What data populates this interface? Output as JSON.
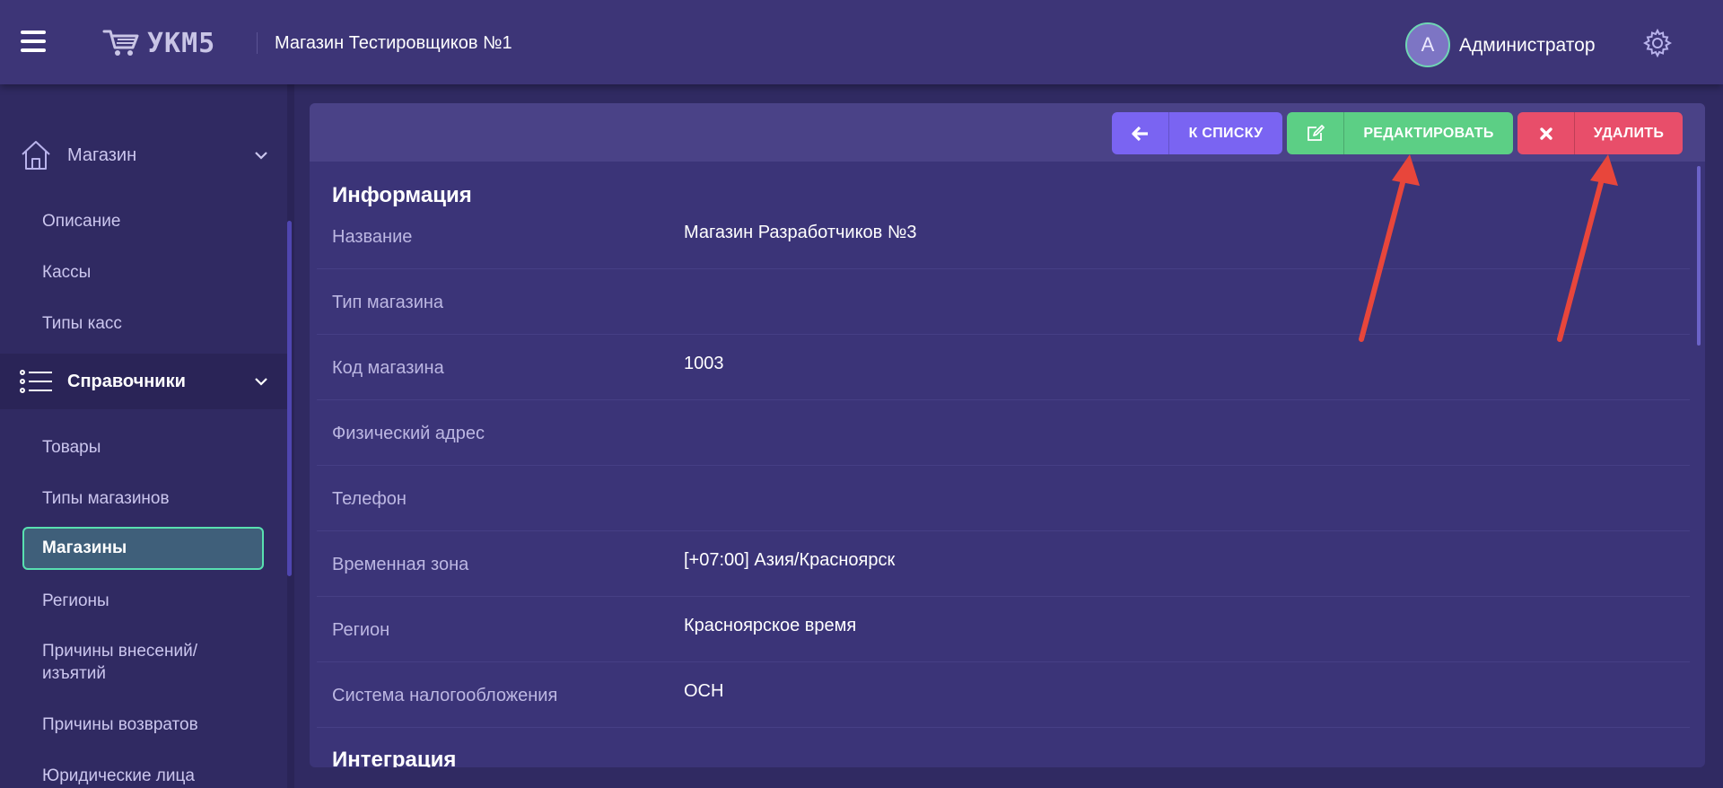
{
  "header": {
    "logo_text": "УКМ5",
    "store_title": "Магазин Тестировщиков №1",
    "avatar_letter": "А",
    "user_name": "Администратор"
  },
  "sidebar": {
    "group_store": {
      "label": "Магазин",
      "icon": "home-icon"
    },
    "store_items": [
      {
        "label": "Описание"
      },
      {
        "label": "Кассы"
      },
      {
        "label": "Типы касс"
      }
    ],
    "group_refs": {
      "label": "Справочники",
      "icon": "list-icon"
    },
    "ref_items": [
      {
        "label": "Товары"
      },
      {
        "label": "Типы магазинов"
      },
      {
        "label": "Магазины",
        "active": true
      },
      {
        "label": "Регионы"
      },
      {
        "label": "Причины внесений/ изъятий"
      },
      {
        "label": "Причины возвратов"
      },
      {
        "label": "Юридические лица"
      }
    ]
  },
  "toolbar": {
    "back_label": "К СПИСКУ",
    "edit_label": "РЕДАКТИРОВАТЬ",
    "delete_label": "УДАЛИТЬ"
  },
  "info": {
    "title": "Информация",
    "fields": [
      {
        "label": "Название",
        "value": "Магазин Разработчиков №3"
      },
      {
        "label": "Тип магазина",
        "value": ""
      },
      {
        "label": "Код магазина",
        "value": "1003"
      },
      {
        "label": "Физический адрес",
        "value": ""
      },
      {
        "label": "Телефон",
        "value": ""
      },
      {
        "label": "Временная зона",
        "value": "[+07:00] Азия/Красноярск"
      },
      {
        "label": "Регион",
        "value": "Красноярское время"
      },
      {
        "label": "Система налогообложения",
        "value": "ОСН"
      }
    ]
  },
  "integration": {
    "title": "Интеграция"
  },
  "colors": {
    "background": "#302a62",
    "header": "#3d3577",
    "panel": "#3b3478",
    "back_button": "#7a64f2",
    "edit_button": "#5ccf85",
    "delete_button": "#e84e6a",
    "active_border": "#58e0b0",
    "annotation_arrow": "#e8463b"
  }
}
